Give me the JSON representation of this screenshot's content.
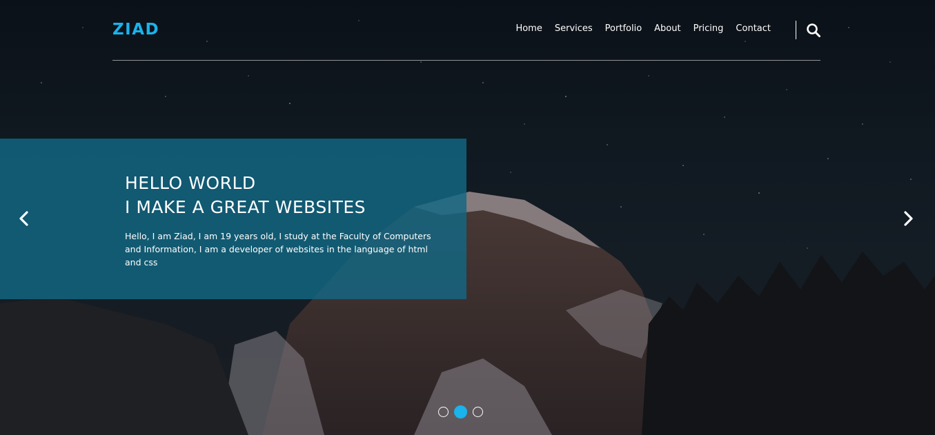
{
  "brand": {
    "logo": "ZIAD",
    "accent_color": "#1ab3ec"
  },
  "nav": {
    "items": [
      {
        "label": "Home"
      },
      {
        "label": "Services"
      },
      {
        "label": "Portfolio"
      },
      {
        "label": "About"
      },
      {
        "label": "Pricing"
      },
      {
        "label": "Contact"
      }
    ],
    "search_icon": "search-icon"
  },
  "hero": {
    "title_line1": "HELLO WORLD",
    "title_line2": "I MAKE A GREAT WEBSITES",
    "description": "Hello, I am Ziad, I am 19 years old, I study at the Faculty of Computers and Information, I am a developer of websites in the language of html and css",
    "panel_color": "#126884",
    "prev_icon": "chevron-left-icon",
    "next_icon": "chevron-right-icon"
  },
  "slider": {
    "slide_count": 3,
    "active_index": 1
  }
}
